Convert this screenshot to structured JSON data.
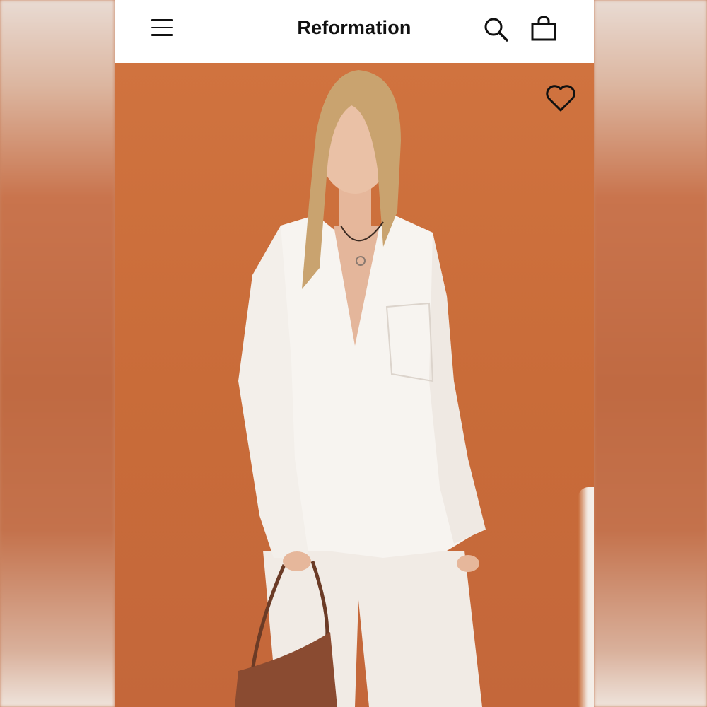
{
  "header": {
    "brand": "Reformation",
    "icons": [
      "menu-icon",
      "search-icon",
      "shopping-bag-icon"
    ]
  },
  "product_image": {
    "icons": [
      "heart-icon"
    ],
    "background_color": "#cd6f3c"
  },
  "colors": {
    "header_bg": "#ffffff",
    "text": "#111111",
    "accent_orange": "#cd6f3c"
  }
}
